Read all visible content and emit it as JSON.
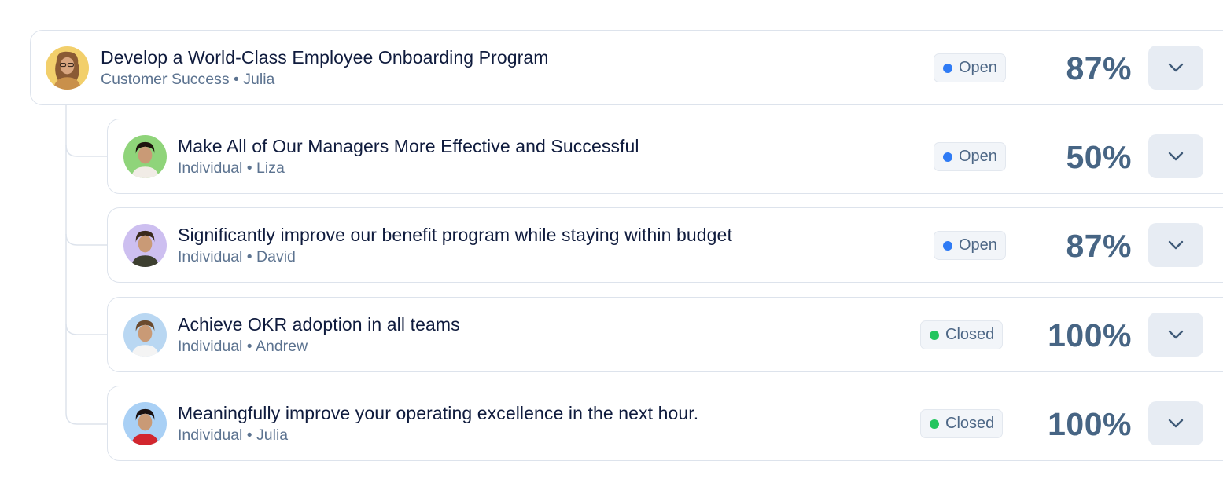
{
  "colors": {
    "open_dot": "#2f7bf5",
    "closed_dot": "#22c55e",
    "title_text": "#0f1b3d",
    "subtitle_text": "#5c7390",
    "percent_text": "#476584",
    "border": "#dde3ec",
    "button_bg": "#e7ecf3"
  },
  "parent": {
    "title": "Develop a World-Class Employee Onboarding Program",
    "team": "Customer Success",
    "owner": "Julia",
    "subtitle": "Customer Success • Julia",
    "status": "Open",
    "status_key": "open",
    "progress": "87%",
    "avatar_bg": "#f2cf6b",
    "expand_icon": "chevron-down-icon"
  },
  "children": [
    {
      "title": "Make All of Our Managers More Effective and Successful",
      "subtitle": "Individual • Liza",
      "owner": "Liza",
      "status": "Open",
      "status_key": "open",
      "progress": "50%",
      "avatar_bg": "#8fd47a",
      "expand_icon": "chevron-down-icon"
    },
    {
      "title": "Significantly improve our benefit program while staying within budget",
      "subtitle": "Individual • David",
      "owner": "David",
      "status": "Open",
      "status_key": "open",
      "progress": "87%",
      "avatar_bg": "#cdbff0",
      "expand_icon": "chevron-down-icon"
    },
    {
      "title": "Achieve OKR adoption in all teams",
      "subtitle": "Individual • Andrew",
      "owner": "Andrew",
      "status": "Closed",
      "status_key": "closed",
      "progress": "100%",
      "avatar_bg": "#b9d7f2",
      "expand_icon": "chevron-down-icon"
    },
    {
      "title": "Meaningfully improve your operating excellence in the next hour.",
      "subtitle": "Individual • Julia",
      "owner": "Julia",
      "status": "Closed",
      "status_key": "closed",
      "progress": "100%",
      "avatar_bg": "#a9d0f5",
      "expand_icon": "chevron-down-icon"
    }
  ]
}
